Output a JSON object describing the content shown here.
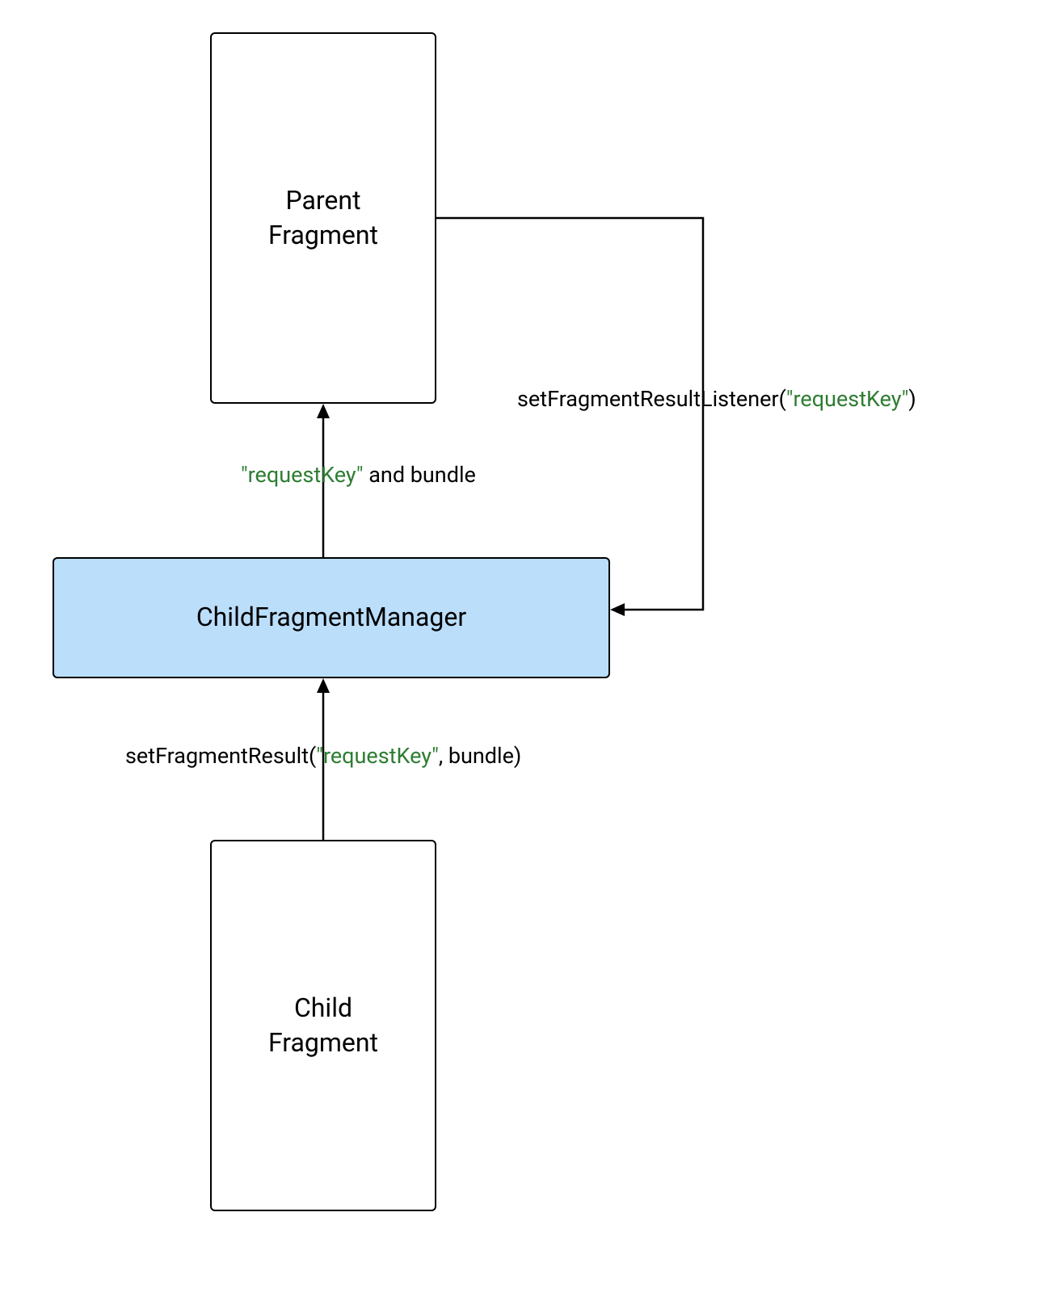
{
  "diagram": {
    "nodes": {
      "parent": {
        "line1": "Parent",
        "line2": "Fragment"
      },
      "manager": {
        "label": "ChildFragmentManager"
      },
      "child": {
        "line1": "Child",
        "line2": "Fragment"
      }
    },
    "edges": {
      "managerToParent": {
        "key": "\"requestKey\"",
        "suffix": " and bundle"
      },
      "parentToManager": {
        "prefix": "setFragmentResultListener(",
        "key": "\"requestKey\"",
        "suffix": ")"
      },
      "childToManager": {
        "prefix": "setFragmentResult(",
        "key": "\"requestKey\"",
        "suffix": ", bundle)"
      }
    },
    "colors": {
      "managerFill": "#bbdefb",
      "keyColor": "#2e7d32"
    }
  }
}
